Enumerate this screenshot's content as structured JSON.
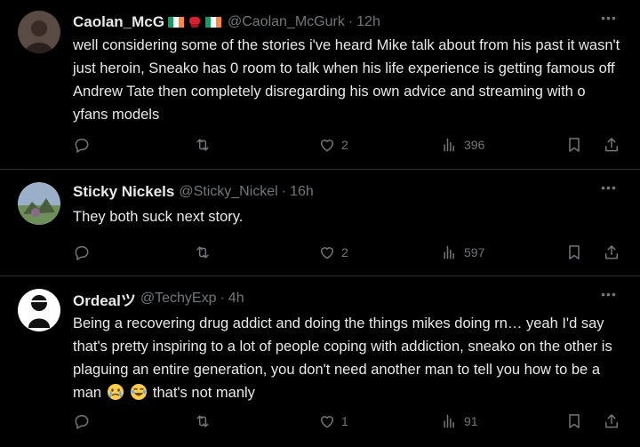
{
  "tweets": [
    {
      "author_name": "Caolan_McG",
      "handle": "@Caolan_McGurk",
      "separator": "·",
      "time": "12h",
      "text": "well considering some of the stories i've heard Mike talk about from his past it wasn't just heroin, Sneako has 0 room to talk when his life experience is getting famous off Andrew Tate then completely disregarding his own advice and streaming with o    yfans models",
      "reply_count": "",
      "retweet_count": "",
      "like_count": "2",
      "view_count": "396"
    },
    {
      "author_name": "Sticky Nickels",
      "handle": "@Sticky_Nickel",
      "separator": "·",
      "time": "16h",
      "text": "They both suck next story.",
      "reply_count": "",
      "retweet_count": "",
      "like_count": "2",
      "view_count": "597"
    },
    {
      "author_name": "Ordealツ",
      "handle": "@TechyExp",
      "separator": "·",
      "time": "4h",
      "text_main": "Being a recovering drug addict and doing the things mikes doing rn… yeah I'd say that's pretty inspiring to a lot of people coping with addiction, sneako on the other is plaguing an entire generation, you don't need another man to tell you how to be a man",
      "text_tail": " that's not manly",
      "reply_count": "",
      "retweet_count": "",
      "like_count": "1",
      "view_count": "91"
    }
  ],
  "more_icon_glyph": "•••",
  "icons": [
    "reply-icon",
    "retweet-icon",
    "like-icon",
    "views-icon",
    "bookmark-icon",
    "share-icon",
    "more-icon",
    "ireland-flag-icon",
    "boxing-glove-icon",
    "crying-emoji-icon",
    "laughing-emoji-icon"
  ],
  "colors": {
    "background": "#000000",
    "text": "#e7e9ea",
    "muted": "#71767b",
    "divider": "#2f3336"
  }
}
